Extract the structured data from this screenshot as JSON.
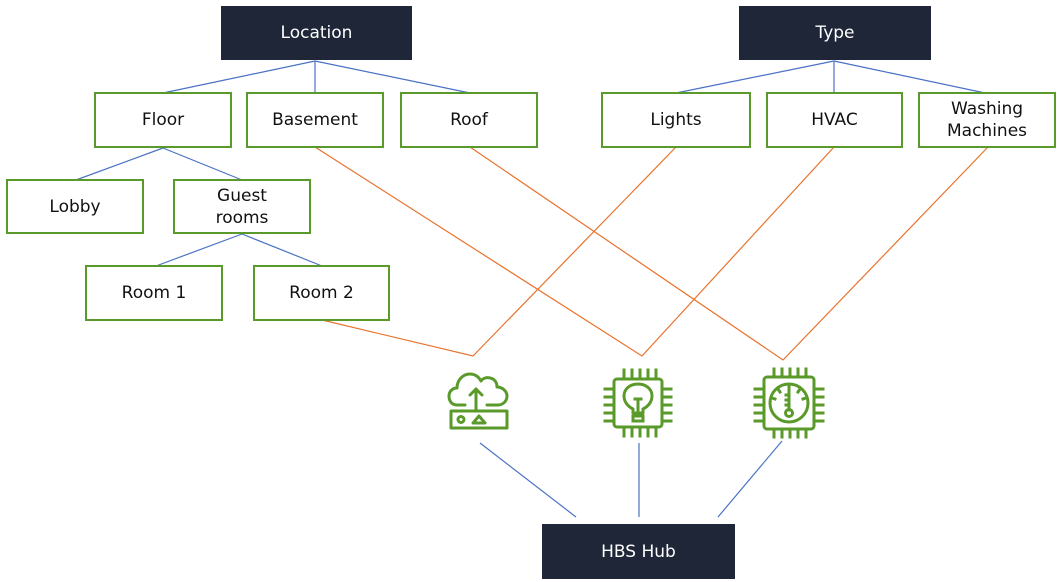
{
  "colors": {
    "dark_node": "#1e2638",
    "green_border": "#5a9a2a",
    "hierarchy_line": "#4a72c4",
    "association_line": "#e8722c",
    "icon_green": "#5a9a2a"
  },
  "roots": {
    "location": "Location",
    "type": "Type",
    "hub": "HBS Hub"
  },
  "location_children": {
    "floor": "Floor",
    "basement": "Basement",
    "roof": "Roof"
  },
  "floor_children": {
    "lobby": "Lobby",
    "guest_rooms": "Guest rooms"
  },
  "guest_rooms_children": {
    "room1": "Room 1",
    "room2": "Room 2"
  },
  "type_children": {
    "lights": "Lights",
    "hvac": "HVAC",
    "washing_machines": "Washing Machines"
  },
  "devices": [
    {
      "name": "cloud-gateway-icon"
    },
    {
      "name": "lightbulb-chip-icon"
    },
    {
      "name": "thermostat-chip-icon"
    }
  ]
}
